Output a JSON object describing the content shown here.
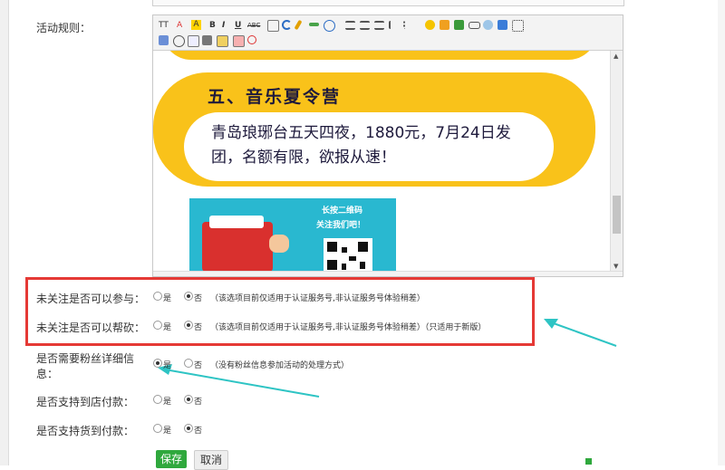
{
  "form": {
    "rules_label": "活动规则：",
    "rows": [
      {
        "label": "未关注是否可以参与：",
        "yes": "是",
        "no": "否",
        "note": "（该选项目前仅适用于认证服务号,非认证服务号体验稍差）",
        "selected": "no"
      },
      {
        "label": "未关注是否可以帮砍：",
        "yes": "是",
        "no": "否",
        "note": "（该选项目前仅适用于认证服务号,非认证服务号体验稍差）（只适用于新版）",
        "selected": "no"
      },
      {
        "label_line1": "是否需要粉丝详细信",
        "label_line2": "息：",
        "yes": "是",
        "no": "否",
        "note": "（没有粉丝信息参加活动的处理方式）",
        "selected": "yes"
      },
      {
        "label": "是否支持到店付款：",
        "yes": "是",
        "no": "否",
        "selected": "no"
      },
      {
        "label": "是否支持货到付款：",
        "yes": "是",
        "no": "否",
        "selected": "no"
      }
    ],
    "save_label": "保存",
    "cancel_label": "取消"
  },
  "editor": {
    "toolbar": [
      "TT",
      "A",
      "A",
      "B",
      "I",
      "U",
      "ABC"
    ],
    "content": {
      "heading": "五、音乐夏令营",
      "body": "青岛琅琊台五天四夜，1880元，7月24日发团，名额有限，欲报从速！",
      "poster_line1": "长按二维码",
      "poster_line2": "关注我们吧！"
    }
  },
  "colors": {
    "highlight_border": "#e53935",
    "arrow": "#2ec4c4",
    "banner_yellow": "#f9c21a",
    "save_green": "#2fa83d"
  }
}
